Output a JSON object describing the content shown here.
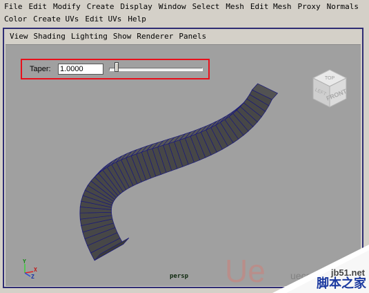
{
  "menubar": {
    "row1": [
      "File",
      "Edit",
      "Modify",
      "Create",
      "Display",
      "Window",
      "Select",
      "Mesh",
      "Edit Mesh",
      "Proxy",
      "Normals"
    ],
    "row2": [
      "Color",
      "Create UVs",
      "Edit UVs",
      "Help"
    ]
  },
  "panel_menu": [
    "View",
    "Shading",
    "Lighting",
    "Show",
    "Renderer",
    "Panels"
  ],
  "taper": {
    "label": "Taper:",
    "value": "1.0000",
    "slider_fraction": 0.08
  },
  "viewcube": {
    "top": "TOP",
    "front": "FRONT",
    "left": "LEFT"
  },
  "axis": {
    "x": "X",
    "y": "Y",
    "z": "Z"
  },
  "camera_label": "persp",
  "watermark": {
    "url": "jb51.net",
    "site_cn": "脚本之家",
    "logo_mark": "Ue",
    "logo_text": "uecg"
  },
  "colors": {
    "frame": "#2e2c73",
    "highlight_box": "#e8101b",
    "viewport_bg": "#a0a0a0",
    "mesh_face": "#474747",
    "mesh_edge": "#1a1a7a"
  }
}
